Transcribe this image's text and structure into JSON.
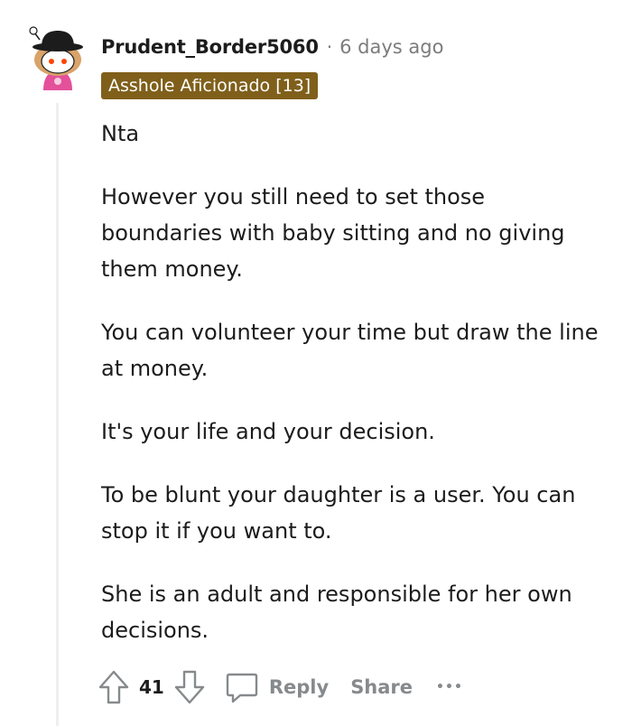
{
  "comment": {
    "username": "Prudent_Border5060",
    "separator": "·",
    "timestamp": "6 days ago",
    "flair": "Asshole Aficionado [13]",
    "paragraphs": [
      "Nta",
      "However you still need to set those boundaries with baby sitting and no giving them money.",
      "You can volunteer your time but draw the line at money.",
      "It's your life and your decision.",
      "To be blunt your daughter is a user. You can stop it if you want to.",
      "She is an adult and responsible for her own decisions."
    ]
  },
  "actions": {
    "score": "41",
    "reply_label": "Reply",
    "share_label": "Share",
    "more_label": "•••"
  },
  "colors": {
    "flair_bg": "#7f5f1a",
    "meta_gray": "#7c7c7c",
    "action_gray": "#878a8c",
    "avatar_pink": "#e4509a"
  },
  "icons": [
    "user-avatar",
    "upvote-icon",
    "downvote-icon",
    "comment-bubble-icon",
    "more-options-icon"
  ]
}
